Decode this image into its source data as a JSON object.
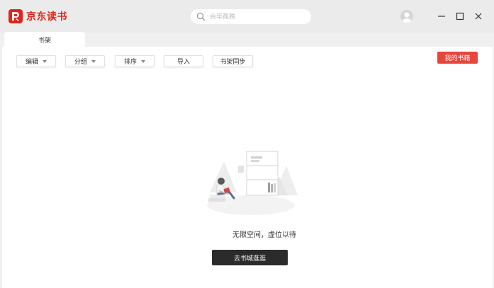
{
  "app": {
    "logo_text": "京东读书",
    "logo_icon": "jd-read-logo"
  },
  "search": {
    "placeholder": "百年孤独",
    "icon": "search-icon"
  },
  "window_controls": {
    "avatar_icon": "user-avatar-icon",
    "minimize_icon": "minimize-icon",
    "maximize_icon": "maximize-icon",
    "close_icon": "close-icon"
  },
  "tabs": [
    {
      "label": "书架",
      "active": true
    }
  ],
  "toolbar": {
    "edit_label": "编辑",
    "group_label": "分组",
    "sort_label": "排序",
    "import_label": "导入",
    "sync_label": "书架同步",
    "my_books_label": "我的书籍"
  },
  "empty_state": {
    "message": "无限空间，虚位以待",
    "button_label": "去书城逛逛",
    "illustration": "reading-person-bookshelf-illustration"
  },
  "colors": {
    "brand_red": "#e1251b",
    "my_books_bg": "#e8453c",
    "primary_button_bg": "#2b2b2b",
    "titlebar_bg": "#ebebeb",
    "content_bg": "#ffffff"
  }
}
